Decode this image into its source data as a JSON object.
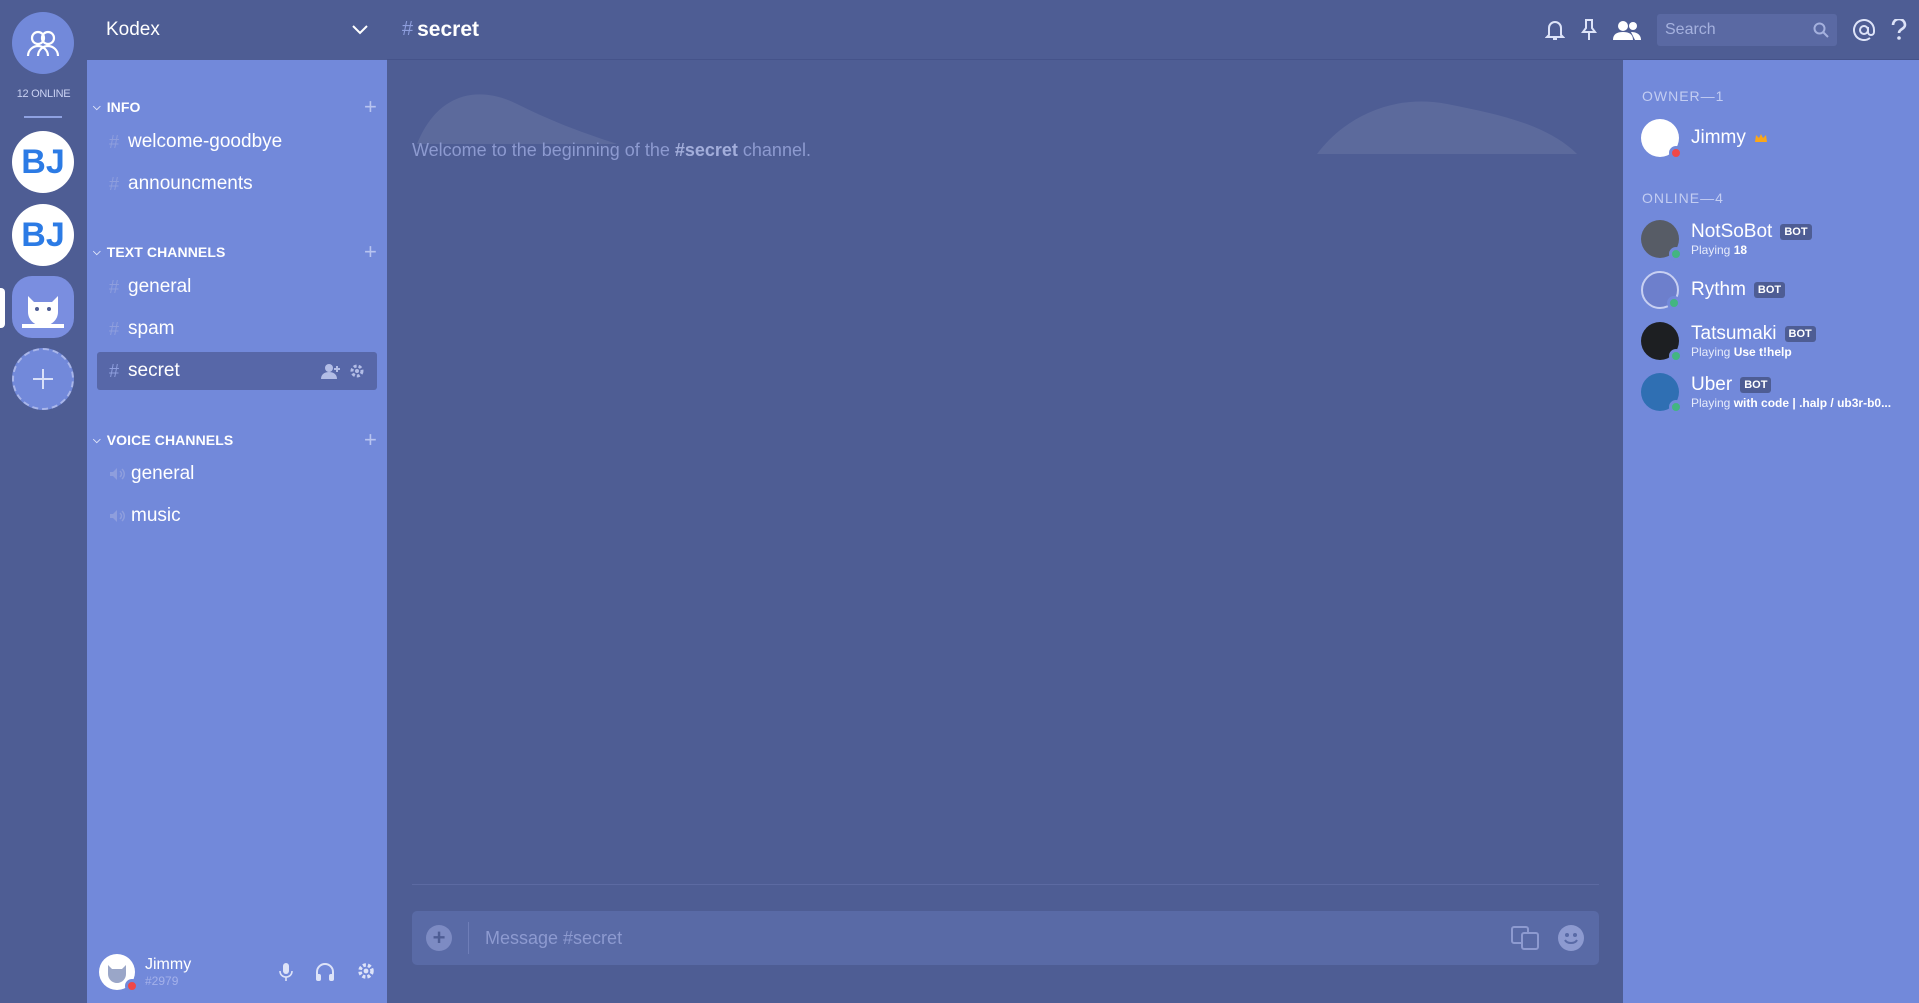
{
  "rail": {
    "online_count": "12 ONLINE",
    "servers": [
      {
        "letter": "BJ"
      },
      {
        "letter": "BJ"
      }
    ]
  },
  "guild": {
    "name": "Kodex"
  },
  "categories": {
    "info": "INFO",
    "text": "TEXT CHANNELS",
    "voice": "VOICE CHANNELS"
  },
  "channels": {
    "info": [
      "welcome-goodbye",
      "announcments"
    ],
    "text": [
      "general",
      "spam",
      "secret"
    ],
    "voice": [
      "general",
      "music"
    ]
  },
  "user": {
    "name": "Jimmy",
    "tag": "#2979"
  },
  "topbar": {
    "channel": "secret",
    "search_placeholder": "Search"
  },
  "chat": {
    "welcome_prefix": "Welcome to the beginning of the ",
    "welcome_channel": "#secret",
    "welcome_suffix": " channel.",
    "composer_placeholder": "Message #secret"
  },
  "members": {
    "owner_header": "OWNER—1",
    "online_header": "ONLINE—4",
    "owner": {
      "name": "Jimmy"
    },
    "list": [
      {
        "name": "NotSoBot",
        "badge": "BOT",
        "status_prefix": "Playing ",
        "status": "18"
      },
      {
        "name": "Rythm",
        "badge": "BOT",
        "status_prefix": "",
        "status": ""
      },
      {
        "name": "Tatsumaki",
        "badge": "BOT",
        "status_prefix": "Playing ",
        "status": "Use t!help"
      },
      {
        "name": "Uber",
        "badge": "BOT",
        "status_prefix": "Playing ",
        "status": "with code | .halp / ub3r-b0..."
      }
    ]
  },
  "colors": {
    "blurple": "#7289da",
    "dark_blurple": "#4e5d94",
    "online": "#43b581",
    "dnd": "#f04747"
  }
}
